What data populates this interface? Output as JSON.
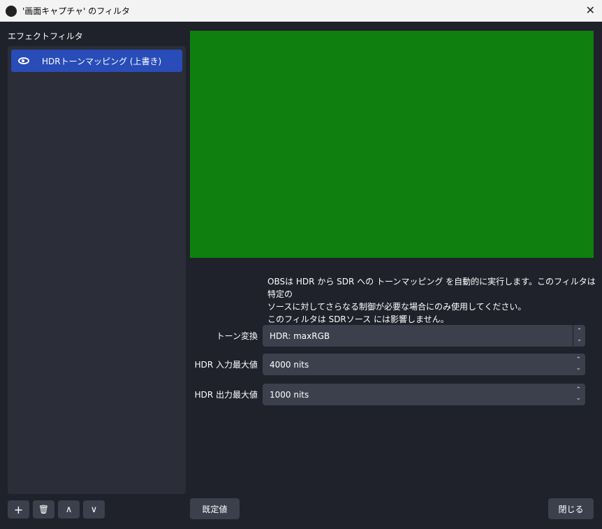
{
  "window": {
    "title": "'画面キャプチャ' のフィルタ",
    "close": "✕"
  },
  "filters": {
    "label": "エフェクトフィルタ",
    "items": [
      {
        "name": "HDRトーンマッピング (上書き)",
        "visible": true
      }
    ]
  },
  "toolbar": {
    "add": "+",
    "remove": "🗑",
    "up": "∧",
    "down": "∨"
  },
  "preview": {
    "color": "#0f7f0f"
  },
  "description": [
    "OBSは HDR から SDR への トーンマッピング を自動的に実行します。このフィルタは特定の",
    "ソースに対してさらなる制御が必要な場合にのみ使用してください。",
    "このフィルタは SDRソース には影響しません。"
  ],
  "settings": {
    "tone_label": "トーン変換",
    "tone_value": "HDR: maxRGB",
    "input_label": "HDR 入力最大値",
    "input_value": "4000 nits",
    "output_label": "HDR 出力最大値",
    "output_value": "1000 nits"
  },
  "buttons": {
    "defaults": "既定値",
    "close": "閉じる"
  }
}
